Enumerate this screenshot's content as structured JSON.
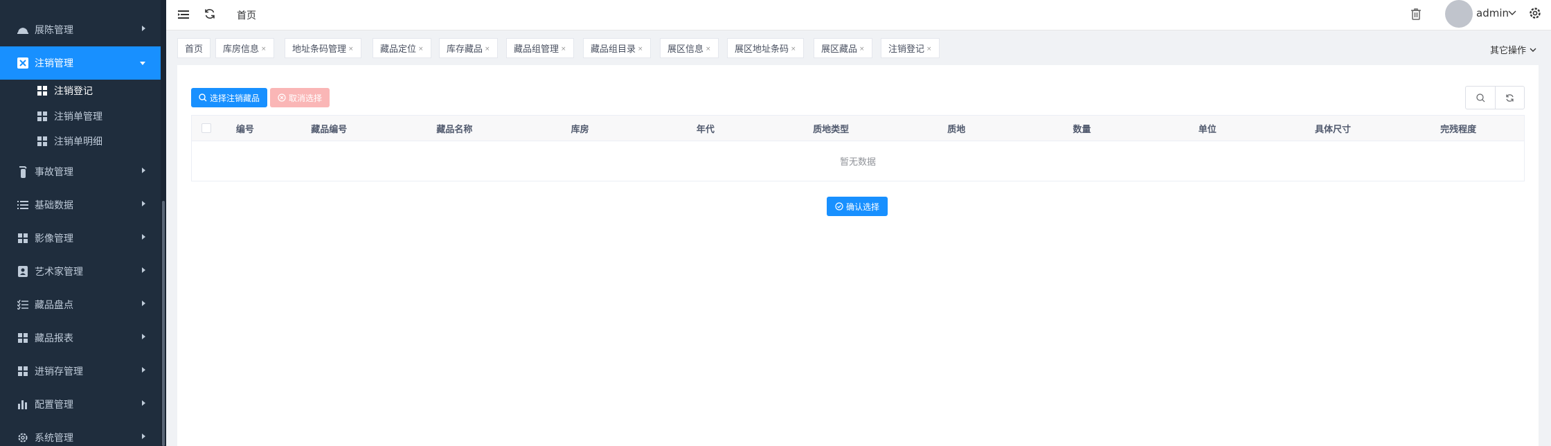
{
  "sidebar": {
    "items": [
      {
        "label": "展陈管理",
        "icon": "cloud-icon"
      },
      {
        "label": "注销管理",
        "icon": "x-box-icon",
        "active": true
      },
      {
        "label": "事故管理",
        "icon": "extinguisher-icon"
      },
      {
        "label": "基础数据",
        "icon": "list-icon"
      },
      {
        "label": "影像管理",
        "icon": "grid-icon"
      },
      {
        "label": "艺术家管理",
        "icon": "contact-icon"
      },
      {
        "label": "藏品盘点",
        "icon": "checklist-icon"
      },
      {
        "label": "藏品报表",
        "icon": "grid-icon"
      },
      {
        "label": "进销存管理",
        "icon": "grid-icon"
      },
      {
        "label": "配置管理",
        "icon": "bar-chart-icon"
      },
      {
        "label": "系统管理",
        "icon": "gear-icon"
      }
    ],
    "subitems": [
      {
        "label": "注销登记",
        "current": true
      },
      {
        "label": "注销单管理"
      },
      {
        "label": "注销单明细"
      }
    ]
  },
  "header": {
    "breadcrumb": "首页",
    "username": "admin"
  },
  "tags": [
    {
      "label": "首页",
      "closable": false
    },
    {
      "label": "库房信息",
      "closable": true
    },
    {
      "label": "地址条码管理",
      "closable": true
    },
    {
      "label": "藏品定位",
      "closable": true
    },
    {
      "label": "库存藏品",
      "closable": true
    },
    {
      "label": "藏品组管理",
      "closable": true
    },
    {
      "label": "藏品组目录",
      "closable": true
    },
    {
      "label": "展区信息",
      "closable": true
    },
    {
      "label": "展区地址条码",
      "closable": true
    },
    {
      "label": "展区藏品",
      "closable": true
    },
    {
      "label": "注销登记",
      "closable": true
    }
  ],
  "tag_close": "×",
  "other_ops": "其它操作",
  "toolbar": {
    "select_label": "选择注销藏品",
    "cancel_label": "取消选择"
  },
  "table": {
    "columns": [
      "编号",
      "藏品编号",
      "藏品名称",
      "库房",
      "年代",
      "质地类型",
      "质地",
      "数量",
      "单位",
      "具体尺寸",
      "完残程度"
    ],
    "empty_text": "暂无数据"
  },
  "confirm_label": "确认选择",
  "colors": {
    "sidebar_bg": "#1f2d3d",
    "primary": "#1890ff",
    "danger_disabled": "#fab6b6"
  }
}
